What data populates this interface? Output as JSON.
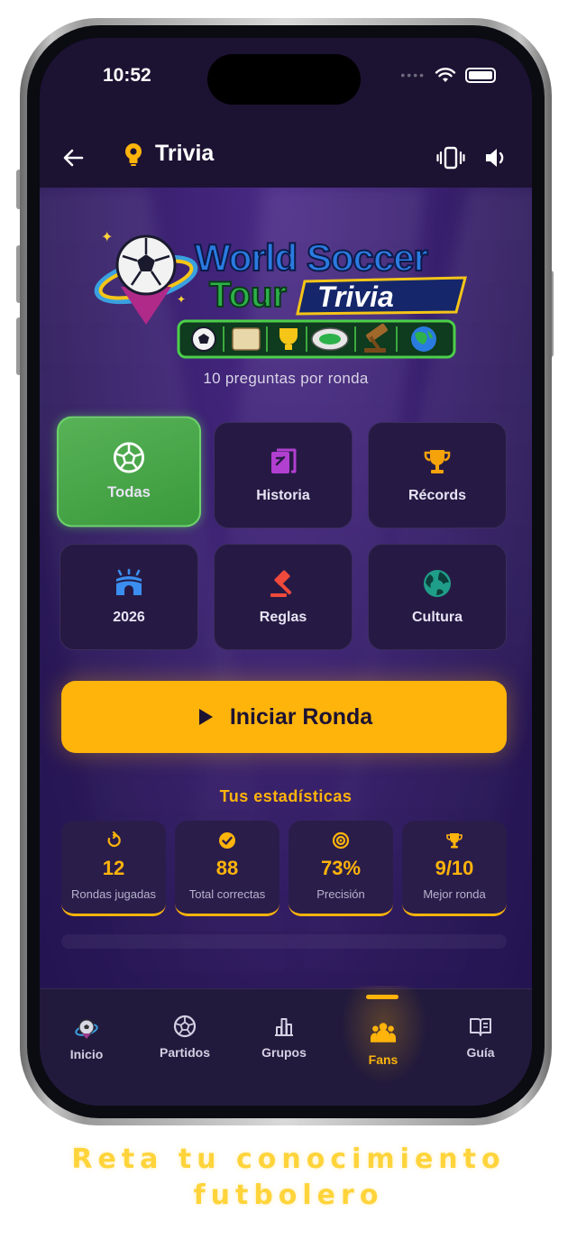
{
  "status_bar": {
    "time": "10:52"
  },
  "header": {
    "title": "Trivia",
    "back_icon": "arrow-left-icon",
    "bulb_icon": "lightbulb-icon",
    "vibrate_icon": "vibrate-icon",
    "sound_icon": "volume-icon"
  },
  "logo": {
    "line1": "World Soccer",
    "line2": "Tour",
    "line3": "Trivia"
  },
  "subtitle": "10 preguntas por ronda",
  "categories": [
    {
      "label": "Todas",
      "icon": "soccer-ball-icon",
      "active": true
    },
    {
      "label": "Historia",
      "icon": "history-icon",
      "active": false
    },
    {
      "label": "Récords",
      "icon": "trophy-icon",
      "active": false
    },
    {
      "label": "2026",
      "icon": "stadium-icon",
      "active": false
    },
    {
      "label": "Reglas",
      "icon": "gavel-icon",
      "active": false
    },
    {
      "label": "Cultura",
      "icon": "globe-icon",
      "active": false
    }
  ],
  "start_button": {
    "label": "Iniciar Ronda",
    "icon": "play-icon"
  },
  "stats": {
    "title": "Tus estadísticas",
    "items": [
      {
        "value": "12",
        "label": "Rondas jugadas",
        "icon": "replay-icon"
      },
      {
        "value": "88",
        "label": "Total correctas",
        "icon": "check-circle-icon"
      },
      {
        "value": "73%",
        "label": "Precisión",
        "icon": "target-icon"
      },
      {
        "value": "9/10",
        "label": "Mejor ronda",
        "icon": "trophy-icon"
      }
    ]
  },
  "tabs": [
    {
      "label": "Inicio",
      "icon": "home-logo-icon",
      "active": false
    },
    {
      "label": "Partidos",
      "icon": "soccer-ball-icon",
      "active": false
    },
    {
      "label": "Grupos",
      "icon": "bar-chart-icon",
      "active": false
    },
    {
      "label": "Fans",
      "icon": "people-icon",
      "active": true
    },
    {
      "label": "Guía",
      "icon": "book-icon",
      "active": false
    }
  ],
  "tagline": {
    "line1": "Reta tu conocimiento",
    "line2": "futbolero"
  },
  "colors": {
    "accent": "#ffb40b",
    "background": "#1c1232",
    "active_green": "#4caf50"
  }
}
